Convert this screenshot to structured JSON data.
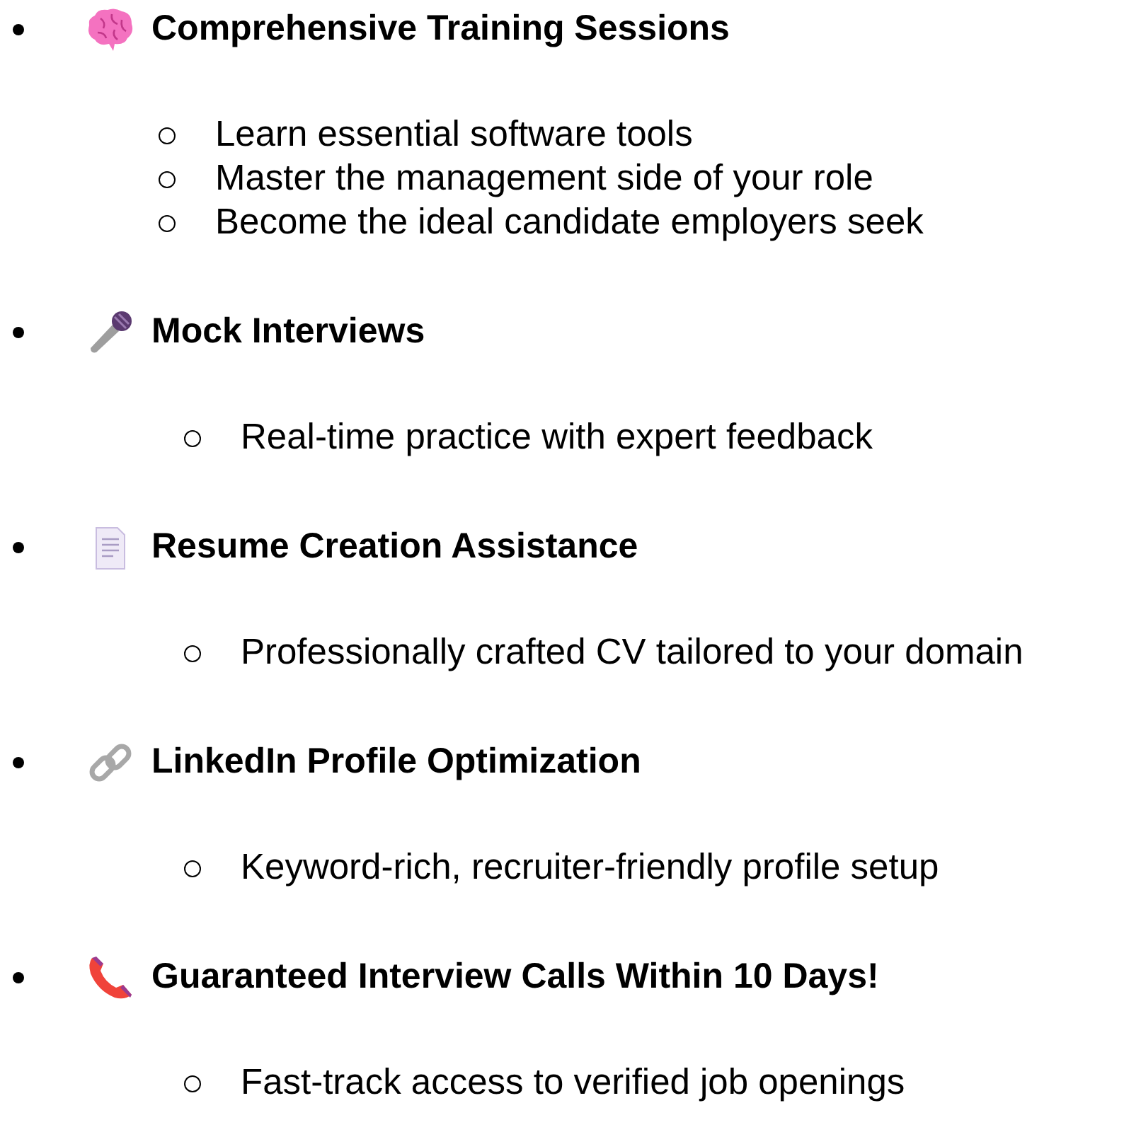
{
  "items": [
    {
      "kind": "brain",
      "title": "Comprehensive Training Sessions",
      "points": [
        "Learn essential software tools",
        "Master the management side of your role",
        "Become the ideal candidate employers seek"
      ]
    },
    {
      "kind": "microphone",
      "title": "Mock Interviews",
      "points": [
        "Real-time practice with expert feedback"
      ]
    },
    {
      "kind": "document",
      "title": "Resume Creation Assistance",
      "points": [
        "Professionally crafted CV tailored to your domain"
      ]
    },
    {
      "kind": "link",
      "title": "LinkedIn Profile Optimization",
      "points": [
        "Keyword-rich, recruiter-friendly profile setup"
      ]
    },
    {
      "kind": "phone",
      "title": "Guaranteed Interview Calls Within 10 Days!",
      "points": [
        "Fast-track access to verified job openings"
      ]
    }
  ]
}
